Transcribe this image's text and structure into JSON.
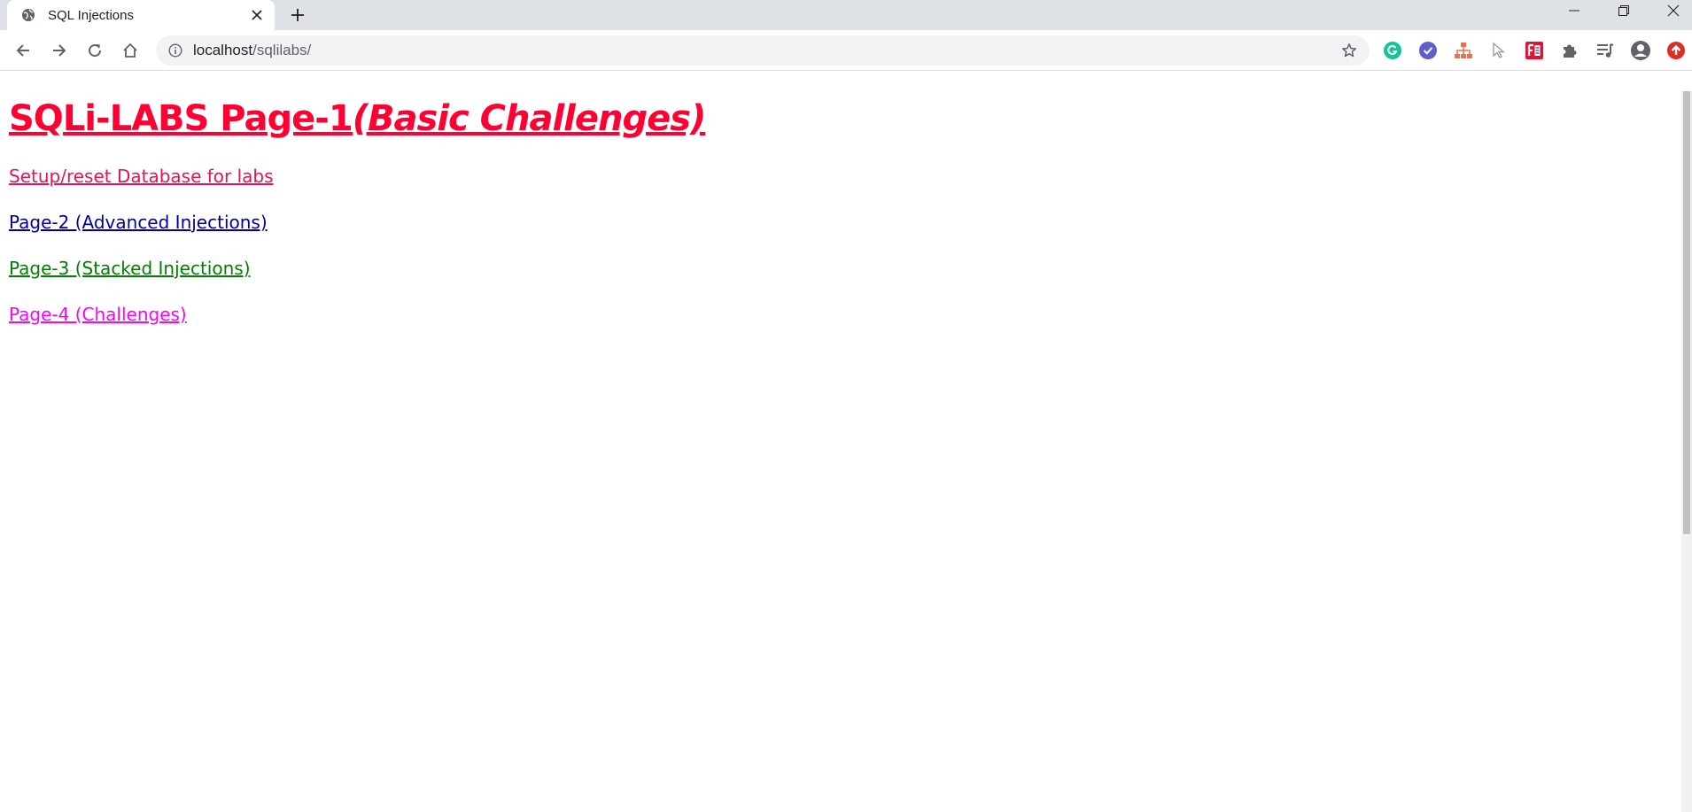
{
  "tab": {
    "title": "SQL Injections"
  },
  "address_bar": {
    "host": "localhost",
    "path": "/sqlilabs/"
  },
  "page": {
    "heading_main": "SQLi-LABS Page-1",
    "heading_sub": "(Basic Challenges)",
    "links": [
      {
        "label": "Setup/reset Database for labs",
        "color": "#e4135a"
      },
      {
        "label": "Page-2 (Advanced Injections)",
        "color": "#0000a0"
      },
      {
        "label": "Page-3 (Stacked Injections)",
        "color": "#008000"
      },
      {
        "label": "Page-4 (Challenges)",
        "color": "#ff00ff"
      }
    ]
  },
  "colors": {
    "heading": "#ff0033",
    "tabstrip": "#dee1e6"
  },
  "icons": {
    "tab_favicon": "globe-icon",
    "extensions": [
      "grammarly-icon",
      "check-circle-icon",
      "sitemap-icon",
      "cursor-icon",
      "fe-helper-icon",
      "puzzle-extensions-icon",
      "reading-list-icon",
      "profile-icon",
      "update-icon"
    ]
  }
}
